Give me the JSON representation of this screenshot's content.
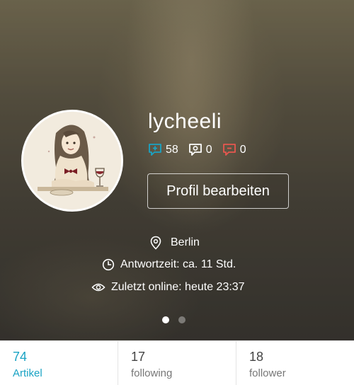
{
  "profile": {
    "username": "lycheeli",
    "edit_button": "Profil bearbeiten",
    "location": "Berlin",
    "response_time": "Antwortzeit: ca. 11 Std.",
    "last_online": "Zuletzt online: heute 23:37"
  },
  "stats": [
    {
      "icon": "comment-plus-icon",
      "value": "58",
      "color": "#1aa3c4"
    },
    {
      "icon": "comment-question-icon",
      "value": "0",
      "color": "#ffffff"
    },
    {
      "icon": "comment-minus-icon",
      "value": "0",
      "color": "#e8574f"
    }
  ],
  "carousel": {
    "active_index": 0,
    "count": 2
  },
  "tabs": [
    {
      "count": "74",
      "label": "Artikel",
      "active": true
    },
    {
      "count": "17",
      "label": "following",
      "active": false
    },
    {
      "count": "18",
      "label": "follower",
      "active": false
    }
  ],
  "colors": {
    "accent": "#1aa3c4",
    "negative": "#e8574f"
  }
}
